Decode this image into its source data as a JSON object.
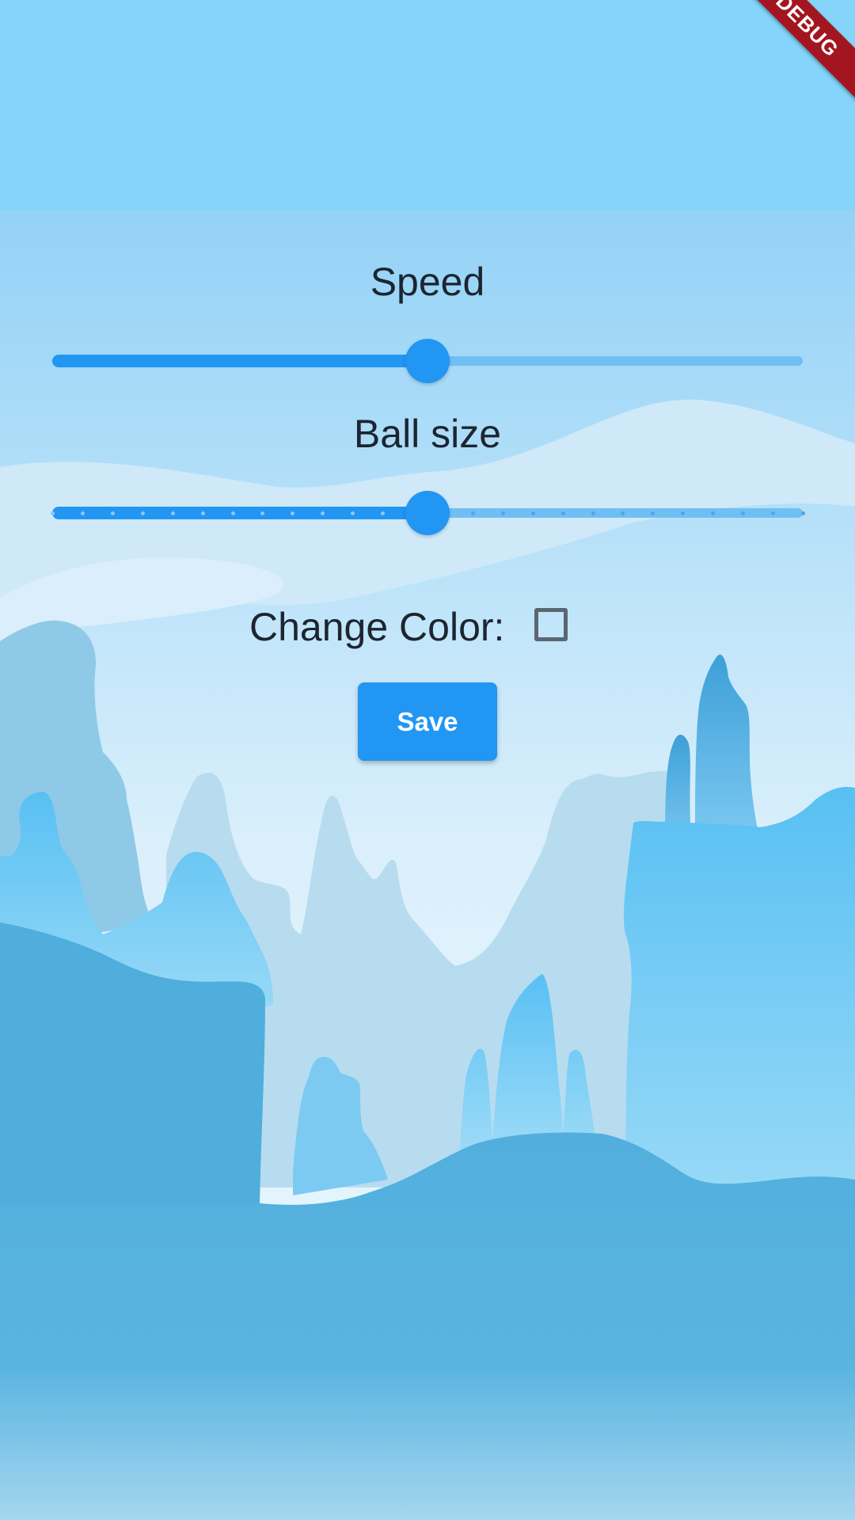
{
  "debug_banner": {
    "label": "DEBUG"
  },
  "settings": {
    "speed": {
      "label": "Speed",
      "value_fraction": 0.5
    },
    "ball_size": {
      "label": "Ball size",
      "value_fraction": 0.5,
      "divisions": 25
    },
    "change_color": {
      "label": "Change Color:",
      "checked": false
    },
    "save_label": "Save"
  },
  "colors": {
    "accent": "#2196f3",
    "inactive_track": "#70bff3",
    "text": "#1c2530",
    "debug_banner": "#a3161f"
  }
}
